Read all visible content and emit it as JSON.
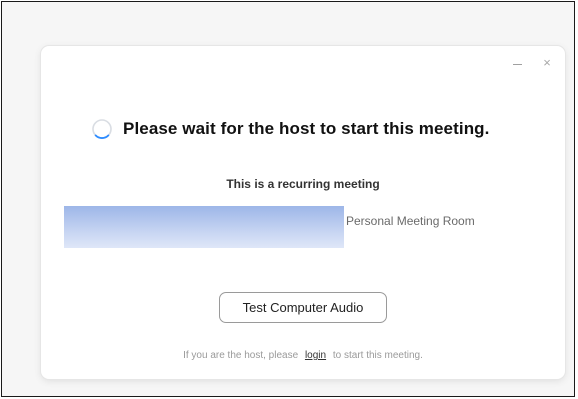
{
  "window": {
    "minimize_symbol": "–",
    "close_symbol": "×"
  },
  "status": {
    "spinner_icon": "loading-spinner-icon",
    "heading": "Please wait for the host to start this meeting.",
    "subheading": "This is a recurring meeting"
  },
  "meeting": {
    "room_label": "Personal Meeting Room"
  },
  "actions": {
    "test_audio_label": "Test Computer Audio"
  },
  "footer": {
    "prefix": "If you are the host, please",
    "login_link": "login",
    "suffix": "to start this meeting."
  },
  "colors": {
    "spinner_track": "#d9dde3",
    "spinner_arc": "#2d8cff",
    "redaction": "#9db6e8"
  }
}
